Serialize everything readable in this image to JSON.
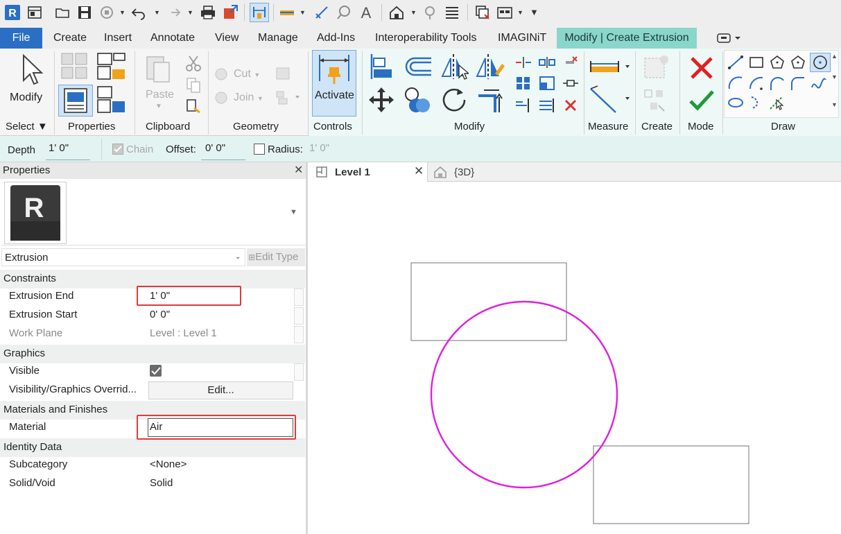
{
  "app": {
    "name": "Revit"
  },
  "ribbon_tabs": [
    "File",
    "Create",
    "Insert",
    "Annotate",
    "View",
    "Manage",
    "Add-Ins",
    "Interoperability Tools",
    "IMAGINiT",
    "Modify | Create Extrusion"
  ],
  "ribbon": {
    "select": {
      "button": "Modify",
      "label": "Select"
    },
    "properties": {
      "label": "Properties"
    },
    "clipboard": {
      "paste": "Paste",
      "label": "Clipboard"
    },
    "geometry": {
      "cut": "Cut",
      "join": "Join",
      "label": "Geometry"
    },
    "controls": {
      "activate": "Activate",
      "label": "Controls"
    },
    "modify": {
      "label": "Modify"
    },
    "measure": {
      "label": "Measure"
    },
    "create": {
      "label": "Create"
    },
    "mode": {
      "label": "Mode"
    },
    "draw": {
      "label": "Draw"
    }
  },
  "options_bar": {
    "depth_label": "Depth",
    "depth_value": "1'  0\"",
    "chain_label": "Chain",
    "chain_checked": true,
    "offset_label": "Offset:",
    "offset_value": "0'  0\"",
    "radius_label": "Radius:",
    "radius_checked": false,
    "radius_value": "1'  0\""
  },
  "properties_panel": {
    "title": "Properties",
    "type_selector": "Extrusion",
    "edit_type": "Edit Type",
    "sections": {
      "constraints": "Constraints",
      "graphics": "Graphics",
      "materials": "Materials and Finishes",
      "identity": "Identity Data"
    },
    "rows": {
      "extrusion_end": {
        "name": "Extrusion End",
        "value": "1'  0\""
      },
      "extrusion_start": {
        "name": "Extrusion Start",
        "value": "0'  0\""
      },
      "work_plane": {
        "name": "Work Plane",
        "value": "Level : Level 1"
      },
      "visible": {
        "name": "Visible",
        "checked": true
      },
      "vis_overrides": {
        "name": "Visibility/Graphics Overrid...",
        "value": "Edit..."
      },
      "material": {
        "name": "Material",
        "value": "Air"
      },
      "subcategory": {
        "name": "Subcategory",
        "value": "<None>"
      },
      "solid_void": {
        "name": "Solid/Void",
        "value": "Solid"
      }
    }
  },
  "view_tabs": [
    {
      "label": "Level 1",
      "active": true
    },
    {
      "label": "{3D}",
      "active": false
    }
  ],
  "colors": {
    "accent_blue": "#2a6fc4",
    "context_tab": "#8ad6cb",
    "sketch_magenta": "#e01ee0",
    "highlight_red": "#e03a3a"
  }
}
